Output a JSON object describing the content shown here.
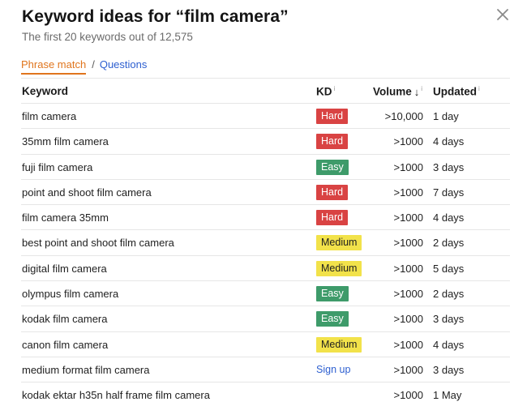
{
  "header": {
    "title": "Keyword ideas for “film camera”",
    "subtitle": "The first 20 keywords out of 12,575"
  },
  "tabs": {
    "active": "Phrase match",
    "separator": "/",
    "other": "Questions"
  },
  "table": {
    "columns": {
      "keyword": "Keyword",
      "kd": "KD",
      "volume": "Volume",
      "updated": "Updated",
      "info_mark": "i",
      "sort_arrow": "↓"
    },
    "rows": [
      {
        "keyword": "film camera",
        "kd": "Hard",
        "kd_level": "hard",
        "volume": ">10,000",
        "updated": "1 day"
      },
      {
        "keyword": "35mm film camera",
        "kd": "Hard",
        "kd_level": "hard",
        "volume": ">1000",
        "updated": "4 days"
      },
      {
        "keyword": "fuji film camera",
        "kd": "Easy",
        "kd_level": "easy",
        "volume": ">1000",
        "updated": "3 days"
      },
      {
        "keyword": "point and shoot film camera",
        "kd": "Hard",
        "kd_level": "hard",
        "volume": ">1000",
        "updated": "7 days"
      },
      {
        "keyword": "film camera 35mm",
        "kd": "Hard",
        "kd_level": "hard",
        "volume": ">1000",
        "updated": "4 days"
      },
      {
        "keyword": "best point and shoot film camera",
        "kd": "Medium",
        "kd_level": "medium",
        "volume": ">1000",
        "updated": "2 days"
      },
      {
        "keyword": "digital film camera",
        "kd": "Medium",
        "kd_level": "medium",
        "volume": ">1000",
        "updated": "5 days"
      },
      {
        "keyword": "olympus film camera",
        "kd": "Easy",
        "kd_level": "easy",
        "volume": ">1000",
        "updated": "2 days"
      },
      {
        "keyword": "kodak film camera",
        "kd": "Easy",
        "kd_level": "easy",
        "volume": ">1000",
        "updated": "3 days"
      },
      {
        "keyword": "canon film camera",
        "kd": "Medium",
        "kd_level": "medium",
        "volume": ">1000",
        "updated": "4 days"
      },
      {
        "keyword": "medium format film camera",
        "kd": "Sign up",
        "kd_level": "signup",
        "volume": ">1000",
        "updated": "3 days"
      },
      {
        "keyword": "kodak ektar h35n half frame film camera",
        "kd": "",
        "kd_level": "none",
        "volume": ">1000",
        "updated": "1 May"
      }
    ]
  },
  "icons": {
    "close": "close-icon"
  },
  "colors": {
    "accent_orange": "#e0751d",
    "link_blue": "#2d5fd0",
    "kd_hard": "#d94343",
    "kd_easy": "#3e9b6a",
    "kd_medium": "#f2e24a"
  }
}
